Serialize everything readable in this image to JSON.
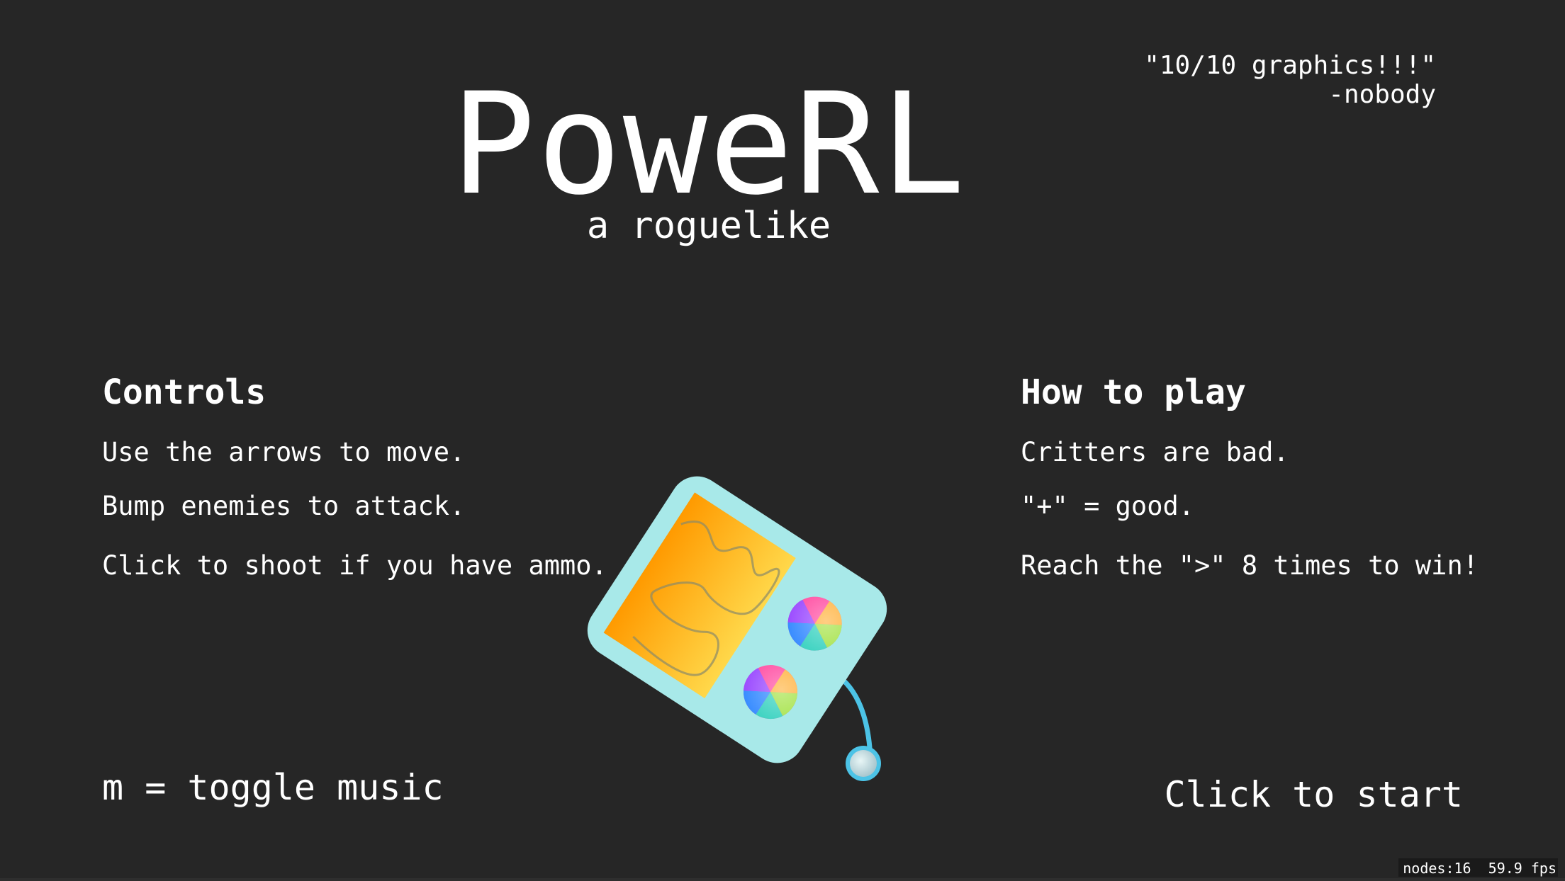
{
  "title": "PoweRL",
  "subtitle": "a roguelike",
  "quote": {
    "text": "\"10/10 graphics!!!\"",
    "author": "-nobody"
  },
  "controls": {
    "heading": "Controls",
    "lines": [
      "Use the arrows to move.",
      "Bump enemies to attack.",
      "Click to shoot if you have ammo."
    ]
  },
  "how_to_play": {
    "heading": "How to play",
    "lines": [
      "Critters are bad.",
      "\"+\" = good.",
      "Reach the \">\" 8 times to win!"
    ]
  },
  "music_hint": "m = toggle music",
  "start_prompt": "Click to start",
  "debug": {
    "nodes": "nodes:16",
    "fps": "59.9 fps"
  },
  "mascot": {
    "icon": "radio-robot-icon",
    "colors": {
      "body": "#a8e9e9",
      "screen_start": "#ff9a00",
      "screen_end": "#ffd84a",
      "cord": "#4cc3e6"
    }
  }
}
